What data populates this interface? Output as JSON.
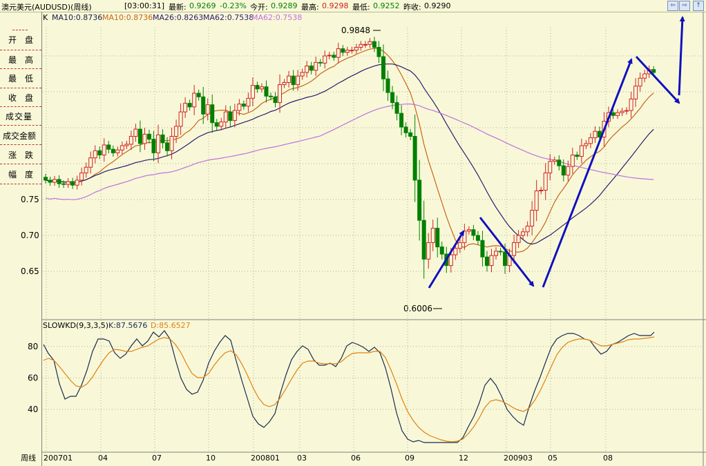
{
  "header": {
    "instrument": "澳元美元(AUDUSD)(周线)",
    "time": "[03:00:31]",
    "latest_label": "最新:",
    "latest_value": "0.9269",
    "change": "-0.23%",
    "open_label": "今开:",
    "open_value": "0.9289",
    "high_label": "最高:",
    "high_value": "0.9298",
    "low_label": "最低:",
    "low_value": "0.9252",
    "prev_label": "昨收:",
    "prev_value": "0.9290"
  },
  "nav_buttons": [
    "⇦",
    "⇨",
    "↑"
  ],
  "left_panel": {
    "items": [
      {
        "a": "开",
        "b": "盘"
      },
      {
        "a": "最",
        "b": "高"
      },
      {
        "a": "最",
        "b": "低"
      },
      {
        "a": "收",
        "b": "盘"
      },
      {
        "a": "成交量",
        "b": ""
      },
      {
        "a": "成交金额",
        "b": ""
      },
      {
        "a": "涨",
        "b": "跌"
      },
      {
        "a": "幅",
        "b": "度"
      }
    ]
  },
  "main_legend": {
    "k": "K",
    "ma10a": "MA10:0.8736",
    "ma10b": "MA10:0.8736",
    "ma26": "MA26:0.8263",
    "ma62a": "MA62:0.7538",
    "ma62b": "MA62:0.7538"
  },
  "colors": {
    "up": "#d02020",
    "down": "#008000",
    "ma10": "#c86418",
    "ma26": "#2a1a6e",
    "ma62": "#c070e0",
    "k_line": "#1a2a50",
    "d_line": "#e08010",
    "arrow": "#1010c0",
    "grid": "#b0b090"
  },
  "annotations": {
    "peak": "0.9848",
    "trough": "0.6006"
  },
  "kd_legend": {
    "name": "SLOWKD(9,3,3,5)",
    "k": "K:87.5676",
    "d": "D:85.6527"
  },
  "x_axis": {
    "label": "周线",
    "ticks": [
      "200701",
      "04",
      "07",
      "10",
      "200801",
      "03",
      "06",
      "09",
      "12",
      "200903",
      "05",
      "08"
    ]
  },
  "chart_data": [
    {
      "type": "candlestick",
      "name": "澳元美元 周线",
      "y_ticks": [
        0.65,
        0.7,
        0.75
      ],
      "ylim": [
        0.6,
        1.0
      ],
      "grid": true,
      "peak": 0.9848,
      "trough": 0.6006,
      "closes": [
        0.777,
        0.774,
        0.778,
        0.772,
        0.771,
        0.775,
        0.77,
        0.777,
        0.787,
        0.795,
        0.808,
        0.818,
        0.812,
        0.826,
        0.82,
        0.815,
        0.819,
        0.825,
        0.827,
        0.838,
        0.848,
        0.828,
        0.841,
        0.834,
        0.815,
        0.84,
        0.829,
        0.818,
        0.838,
        0.852,
        0.872,
        0.884,
        0.879,
        0.898,
        0.893,
        0.869,
        0.882,
        0.857,
        0.852,
        0.858,
        0.872,
        0.86,
        0.874,
        0.883,
        0.88,
        0.891,
        0.909,
        0.904,
        0.907,
        0.894,
        0.893,
        0.885,
        0.91,
        0.913,
        0.922,
        0.91,
        0.922,
        0.927,
        0.936,
        0.93,
        0.941,
        0.94,
        0.95,
        0.951,
        0.948,
        0.96,
        0.955,
        0.958,
        0.958,
        0.962,
        0.966,
        0.966,
        0.97,
        0.962,
        0.949,
        0.918,
        0.899,
        0.885,
        0.87,
        0.851,
        0.843,
        0.838,
        0.777,
        0.721,
        0.667,
        0.69,
        0.71,
        0.684,
        0.674,
        0.658,
        0.673,
        0.682,
        0.69,
        0.706,
        0.708,
        0.7,
        0.693,
        0.67,
        0.658,
        0.672,
        0.678,
        0.677,
        0.658,
        0.672,
        0.69,
        0.7,
        0.705,
        0.713,
        0.735,
        0.762,
        0.763,
        0.787,
        0.803,
        0.805,
        0.797,
        0.784,
        0.796,
        0.812,
        0.81,
        0.825,
        0.828,
        0.836,
        0.845,
        0.837,
        0.859,
        0.871,
        0.867,
        0.871,
        0.873,
        0.874,
        0.89,
        0.908,
        0.919,
        0.925,
        0.931,
        0.927
      ]
    },
    {
      "type": "line",
      "name": "SLOWKD",
      "y_ticks": [
        40,
        60,
        80
      ],
      "ylim": [
        15,
        100
      ],
      "series": [
        {
          "name": "K",
          "points": [
            [
              63,
              499
            ],
            [
              70,
              512
            ],
            [
              78,
              522
            ],
            [
              86,
              556
            ],
            [
              94,
              578
            ],
            [
              102,
              574
            ],
            [
              110,
              574
            ],
            [
              118,
              558
            ],
            [
              126,
              536
            ],
            [
              134,
              509
            ],
            [
              142,
              491
            ],
            [
              150,
              491
            ],
            [
              158,
              494
            ],
            [
              166,
              511
            ],
            [
              174,
              519
            ],
            [
              182,
              513
            ],
            [
              190,
              501
            ],
            [
              198,
              491
            ],
            [
              206,
              501
            ],
            [
              214,
              494
            ],
            [
              222,
              481
            ],
            [
              230,
              488
            ],
            [
              238,
              479
            ],
            [
              246,
              491
            ],
            [
              254,
              521
            ],
            [
              262,
              548
            ],
            [
              270,
              564
            ],
            [
              278,
              571
            ],
            [
              286,
              568
            ],
            [
              294,
              551
            ],
            [
              302,
              526
            ],
            [
              310,
              509
            ],
            [
              318,
              496
            ],
            [
              326,
              486
            ],
            [
              334,
              493
            ],
            [
              342,
              523
            ],
            [
              350,
              551
            ],
            [
              358,
              577
            ],
            [
              366,
              603
            ],
            [
              374,
              614
            ],
            [
              382,
              619
            ],
            [
              390,
              611
            ],
            [
              398,
              599
            ],
            [
              406,
              569
            ],
            [
              414,
              543
            ],
            [
              422,
              521
            ],
            [
              430,
              509
            ],
            [
              438,
              501
            ],
            [
              446,
              506
            ],
            [
              454,
              521
            ],
            [
              462,
              529
            ],
            [
              470,
              529
            ],
            [
              478,
              526
            ],
            [
              486,
              531
            ],
            [
              494,
              519
            ],
            [
              502,
              501
            ],
            [
              510,
              496
            ],
            [
              518,
              499
            ],
            [
              526,
              503
            ],
            [
              534,
              509
            ],
            [
              542,
              503
            ],
            [
              550,
              511
            ],
            [
              558,
              533
            ],
            [
              566,
              563
            ],
            [
              574,
              598
            ],
            [
              582,
              624
            ],
            [
              590,
              636
            ],
            [
              598,
              640
            ],
            [
              606,
              638
            ],
            [
              614,
              641
            ],
            [
              622,
              641
            ],
            [
              630,
              641
            ],
            [
              638,
              641
            ],
            [
              646,
              641
            ],
            [
              654,
              641
            ],
            [
              662,
              641
            ],
            [
              670,
              634
            ],
            [
              678,
              618
            ],
            [
              686,
              603
            ],
            [
              694,
              583
            ],
            [
              702,
              558
            ],
            [
              710,
              548
            ],
            [
              718,
              558
            ],
            [
              726,
              574
            ],
            [
              734,
              593
            ],
            [
              742,
              603
            ],
            [
              750,
              611
            ],
            [
              758,
              616
            ],
            [
              766,
              589
            ],
            [
              774,
              566
            ],
            [
              782,
              546
            ],
            [
              790,
              524
            ],
            [
              798,
              503
            ],
            [
              806,
              491
            ],
            [
              814,
              486
            ],
            [
              822,
              483
            ],
            [
              830,
              483
            ],
            [
              838,
              486
            ],
            [
              846,
              491
            ],
            [
              854,
              493
            ],
            [
              862,
              504
            ],
            [
              870,
              513
            ],
            [
              878,
              509
            ],
            [
              886,
              499
            ],
            [
              894,
              496
            ],
            [
              902,
              491
            ],
            [
              910,
              486
            ],
            [
              918,
              483
            ],
            [
              926,
              486
            ],
            [
              934,
              486
            ],
            [
              942,
              486
            ],
            [
              947,
              481
            ]
          ]
        },
        {
          "name": "D",
          "points": [
            [
              63,
              522
            ],
            [
              70,
              519
            ],
            [
              78,
              522
            ],
            [
              86,
              531
            ],
            [
              94,
              541
            ],
            [
              102,
              551
            ],
            [
              110,
              559
            ],
            [
              118,
              561
            ],
            [
              126,
              556
            ],
            [
              134,
              546
            ],
            [
              142,
              533
            ],
            [
              150,
              521
            ],
            [
              158,
              511
            ],
            [
              166,
              506
            ],
            [
              174,
              507
            ],
            [
              182,
              509
            ],
            [
              190,
              509
            ],
            [
              198,
              506
            ],
            [
              206,
              503
            ],
            [
              214,
              501
            ],
            [
              222,
              496
            ],
            [
              230,
              491
            ],
            [
              238,
              489
            ],
            [
              246,
              491
            ],
            [
              254,
              499
            ],
            [
              262,
              511
            ],
            [
              270,
              527
            ],
            [
              278,
              541
            ],
            [
              286,
              547
            ],
            [
              294,
              547
            ],
            [
              302,
              541
            ],
            [
              310,
              529
            ],
            [
              318,
              519
            ],
            [
              326,
              511
            ],
            [
              334,
              508
            ],
            [
              342,
              514
            ],
            [
              350,
              527
            ],
            [
              358,
              543
            ],
            [
              366,
              561
            ],
            [
              374,
              576
            ],
            [
              382,
              586
            ],
            [
              390,
              589
            ],
            [
              398,
              586
            ],
            [
              406,
              576
            ],
            [
              414,
              563
            ],
            [
              422,
              549
            ],
            [
              430,
              536
            ],
            [
              438,
              526
            ],
            [
              446,
              523
            ],
            [
              454,
              523
            ],
            [
              462,
              526
            ],
            [
              470,
              527
            ],
            [
              478,
              527
            ],
            [
              486,
              527
            ],
            [
              494,
              524
            ],
            [
              502,
              517
            ],
            [
              510,
              512
            ],
            [
              518,
              511
            ],
            [
              526,
              511
            ],
            [
              534,
              511
            ],
            [
              542,
              509
            ],
            [
              550,
              509
            ],
            [
              558,
              518
            ],
            [
              566,
              536
            ],
            [
              574,
              556
            ],
            [
              582,
              578
            ],
            [
              590,
              596
            ],
            [
              598,
              609
            ],
            [
              606,
              619
            ],
            [
              614,
              626
            ],
            [
              622,
              631
            ],
            [
              630,
              634
            ],
            [
              638,
              637
            ],
            [
              646,
              639
            ],
            [
              654,
              640
            ],
            [
              662,
              639
            ],
            [
              670,
              636
            ],
            [
              678,
              628
            ],
            [
              686,
              618
            ],
            [
              694,
              605
            ],
            [
              702,
              590
            ],
            [
              710,
              581
            ],
            [
              718,
              579
            ],
            [
              726,
              581
            ],
            [
              734,
              585
            ],
            [
              742,
              590
            ],
            [
              750,
              594
            ],
            [
              758,
              596
            ],
            [
              766,
              591
            ],
            [
              774,
              580
            ],
            [
              782,
              566
            ],
            [
              790,
              549
            ],
            [
              798,
              531
            ],
            [
              806,
              514
            ],
            [
              814,
              503
            ],
            [
              822,
              496
            ],
            [
              830,
              493
            ],
            [
              838,
              491
            ],
            [
              846,
              491
            ],
            [
              854,
              493
            ],
            [
              862,
              497
            ],
            [
              870,
              501
            ],
            [
              878,
              501
            ],
            [
              886,
              499
            ],
            [
              894,
              497
            ],
            [
              902,
              495
            ],
            [
              910,
              492
            ],
            [
              918,
              491
            ],
            [
              926,
              491
            ],
            [
              934,
              490
            ],
            [
              942,
              489
            ],
            [
              947,
              488
            ]
          ]
        }
      ]
    }
  ]
}
